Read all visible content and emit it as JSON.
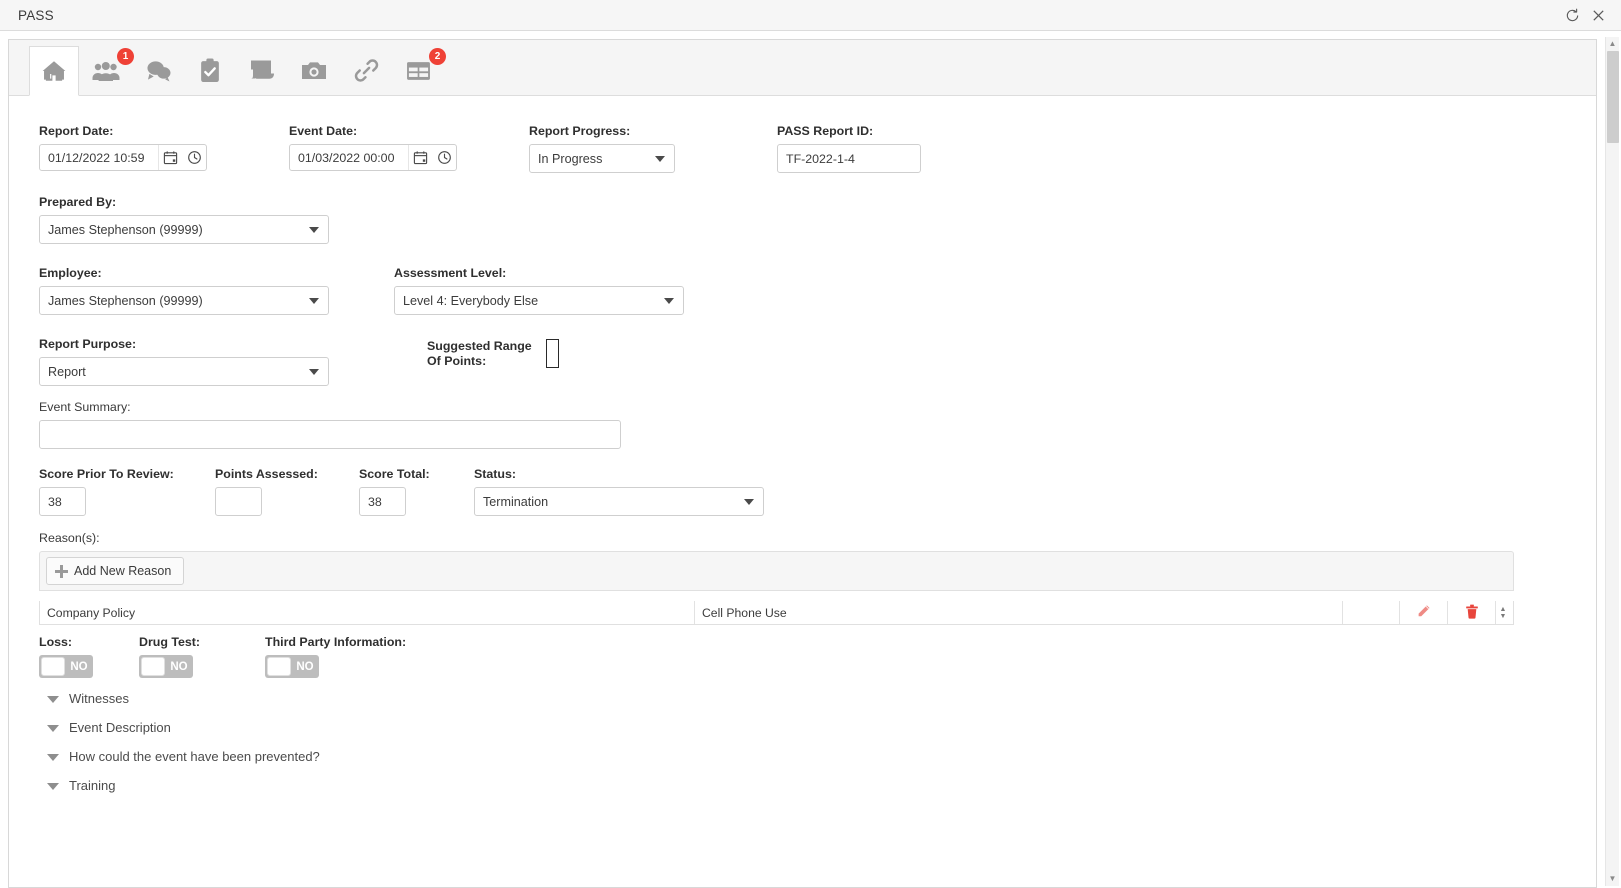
{
  "window": {
    "title": "PASS",
    "refresh_icon": "refresh-icon",
    "close_icon": "close-icon"
  },
  "tabs": [
    {
      "name": "home",
      "icon": "home-icon",
      "active": true,
      "badge": ""
    },
    {
      "name": "people",
      "icon": "people-icon",
      "active": false,
      "badge": "1"
    },
    {
      "name": "comments",
      "icon": "comments-icon",
      "active": false,
      "badge": ""
    },
    {
      "name": "tasks",
      "icon": "clipboard-check-icon",
      "active": false,
      "badge": ""
    },
    {
      "name": "documents",
      "icon": "scroll-icon",
      "active": false,
      "badge": ""
    },
    {
      "name": "photos",
      "icon": "camera-icon",
      "active": false,
      "badge": ""
    },
    {
      "name": "links",
      "icon": "link-icon",
      "active": false,
      "badge": ""
    },
    {
      "name": "tables",
      "icon": "table-icon",
      "active": false,
      "badge": "2"
    }
  ],
  "form": {
    "report_date": {
      "label": "Report Date:",
      "value": "01/12/2022 10:59",
      "calendar_icon": "calendar-icon",
      "clock_icon": "clock-icon"
    },
    "event_date": {
      "label": "Event Date:",
      "value": "01/03/2022 00:00",
      "calendar_icon": "calendar-icon",
      "clock_icon": "clock-icon"
    },
    "report_progress": {
      "label": "Report Progress:",
      "value": "In Progress"
    },
    "pass_report_id": {
      "label": "PASS Report ID:",
      "value": "TF-2022-1-4"
    },
    "prepared_by": {
      "label": "Prepared By:",
      "value": "James Stephenson (99999)"
    },
    "employee": {
      "label": "Employee:",
      "value": "James Stephenson (99999)"
    },
    "assessment_level": {
      "label": "Assessment Level:",
      "value": "Level 4: Everybody Else"
    },
    "report_purpose": {
      "label": "Report Purpose:",
      "value": "Report"
    },
    "suggested_range": {
      "label_line1": "Suggested Range",
      "label_line2": "Of Points:",
      "value": ""
    },
    "event_summary": {
      "label": "Event Summary:",
      "value": ""
    },
    "score_prior": {
      "label": "Score Prior To Review:",
      "value": "38"
    },
    "points_assessed": {
      "label": "Points Assessed:",
      "value": ""
    },
    "score_total": {
      "label": "Score Total:",
      "value": "38"
    },
    "status": {
      "label": "Status:",
      "value": "Termination"
    }
  },
  "reasons": {
    "label": "Reason(s):",
    "add_button": "Add New Reason",
    "add_icon": "plus-icon",
    "rows": [
      {
        "category": "Company Policy",
        "detail": "Cell Phone Use",
        "col3": "",
        "col4": "",
        "edit_icon": "pencil-icon",
        "delete_icon": "trash-icon"
      }
    ]
  },
  "toggles": [
    {
      "label": "Loss:",
      "value": "NO"
    },
    {
      "label": "Drug Test:",
      "value": "NO"
    },
    {
      "label": "Third Party Information:",
      "value": "NO"
    }
  ],
  "sections": [
    {
      "label": "Witnesses"
    },
    {
      "label": "Event Description"
    },
    {
      "label": "How could the event have been prevented?"
    },
    {
      "label": "Training"
    }
  ],
  "colors": {
    "badge": "#ef4136",
    "delete": "#e8453c",
    "edit": "#ef8b85",
    "toggle_off": "#bdbdbd"
  }
}
